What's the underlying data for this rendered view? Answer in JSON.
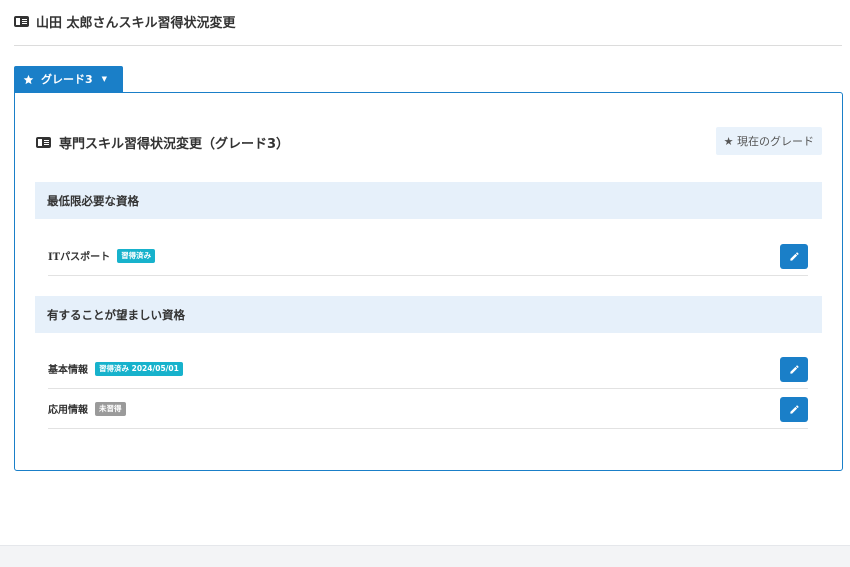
{
  "page": {
    "title": "山田 太郎さんスキル習得状況変更",
    "icon": "id-card-icon"
  },
  "grade_tab": {
    "label": "グレード3",
    "icon": "star-icon",
    "dropdown": "caret-down-icon"
  },
  "panel": {
    "title": "専門スキル習得状況変更（グレード3）",
    "current_grade_label": "★ 現在のグレード"
  },
  "sections": [
    {
      "header": "最低限必要な資格",
      "items": [
        {
          "name": "ITパスポート",
          "status": "習得済み",
          "status_type": "done"
        }
      ]
    },
    {
      "header": "有することが望ましい資格",
      "items": [
        {
          "name": "基本情報",
          "status": "習得済み 2024/05/01",
          "status_type": "done"
        },
        {
          "name": "応用情報",
          "status": "未習得",
          "status_type": "notyet"
        }
      ]
    }
  ],
  "colors": {
    "primary": "#1a7fc8",
    "badge_done": "#17b2cc",
    "badge_notyet": "#9a9a9a",
    "section_bg": "#e6f0fa"
  }
}
